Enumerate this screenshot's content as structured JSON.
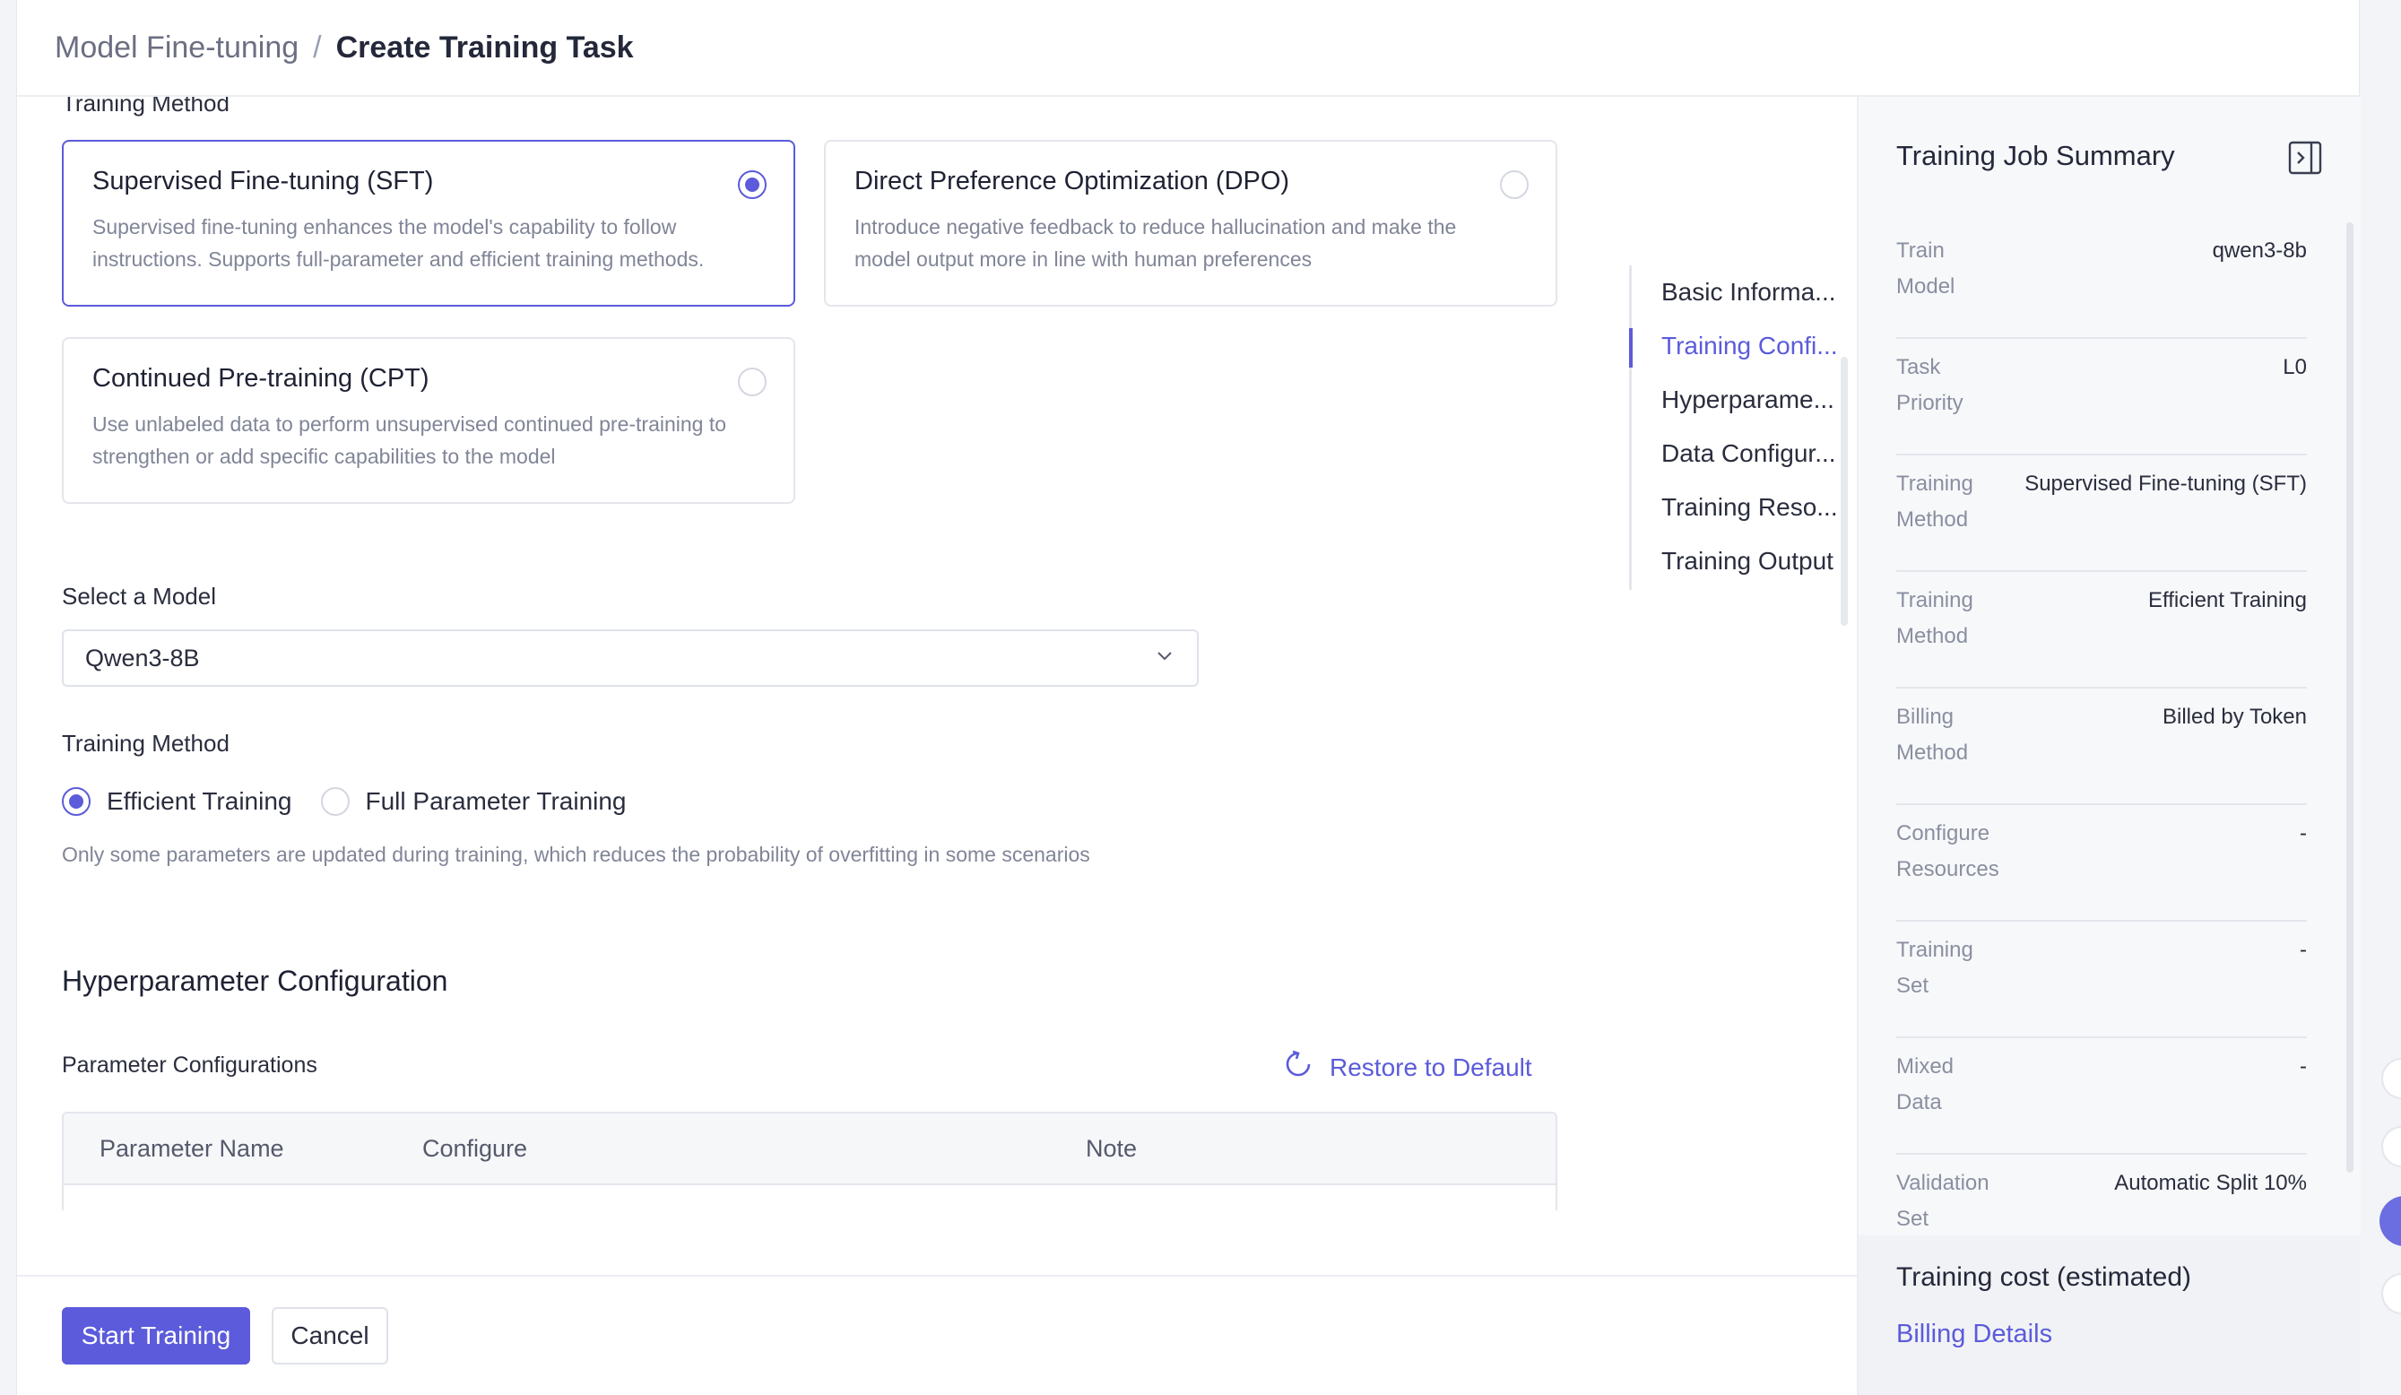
{
  "breadcrumb": {
    "parent": "Model Fine-tuning",
    "separator": "/",
    "current": "Create Training Task"
  },
  "training_method_section": {
    "label": "Training Method",
    "options": [
      {
        "title": "Supervised Fine-tuning (SFT)",
        "description": "Supervised fine-tuning enhances the model's capability to follow instructions. Supports full-parameter and efficient training methods.",
        "selected": true
      },
      {
        "title": "Direct Preference Optimization (DPO)",
        "description": "Introduce negative feedback to reduce hallucination and make the model output more in line with human preferences",
        "selected": false
      },
      {
        "title": "Continued Pre-training (CPT)",
        "description": "Use unlabeled data to perform unsupervised continued pre-training to strengthen or add specific capabilities to the model",
        "selected": false
      }
    ]
  },
  "model_select": {
    "label": "Select a Model",
    "value": "Qwen3-8B"
  },
  "training_mode": {
    "label": "Training Method",
    "options": [
      {
        "label": "Efficient Training",
        "checked": true
      },
      {
        "label": "Full Parameter Training",
        "checked": false
      }
    ],
    "hint": "Only some parameters are updated during training, which reduces the probability of overfitting in some scenarios"
  },
  "hyperparameters": {
    "heading": "Hyperparameter Configuration",
    "param_label": "Parameter Configurations",
    "restore_label": "Restore to Default",
    "table_headers": [
      "Parameter Name",
      "Configure",
      "Note"
    ]
  },
  "anchor_nav": {
    "items": [
      "Basic Informa...",
      "Training Confi...",
      "Hyperparame...",
      "Data Configur...",
      "Training Reso...",
      "Training Output"
    ],
    "active_index": 1
  },
  "footer": {
    "start_label": "Start Training",
    "cancel_label": "Cancel"
  },
  "summary": {
    "title": "Training Job Summary",
    "rows": [
      {
        "key": "Train Model",
        "value": "qwen3-8b"
      },
      {
        "key": "Task Priority",
        "value": "L0"
      },
      {
        "key": "Training Method",
        "value": "Supervised Fine-tuning (SFT)"
      },
      {
        "key": "Training Method",
        "value": "Efficient Training"
      },
      {
        "key": "Billing Method",
        "value": "Billed by Token"
      },
      {
        "key": "Configure Resources",
        "value": "-"
      },
      {
        "key": "Training Set",
        "value": "-"
      },
      {
        "key": "Mixed Data",
        "value": "-"
      },
      {
        "key": "Validation Set",
        "value": "Automatic Split 10%"
      }
    ],
    "cost_title": "Training cost (estimated)",
    "billing_link": "Billing Details"
  },
  "colors": {
    "accent": "#5b5bdb",
    "text": "#1f2233",
    "muted": "#808597",
    "border": "#e4e6ec"
  }
}
